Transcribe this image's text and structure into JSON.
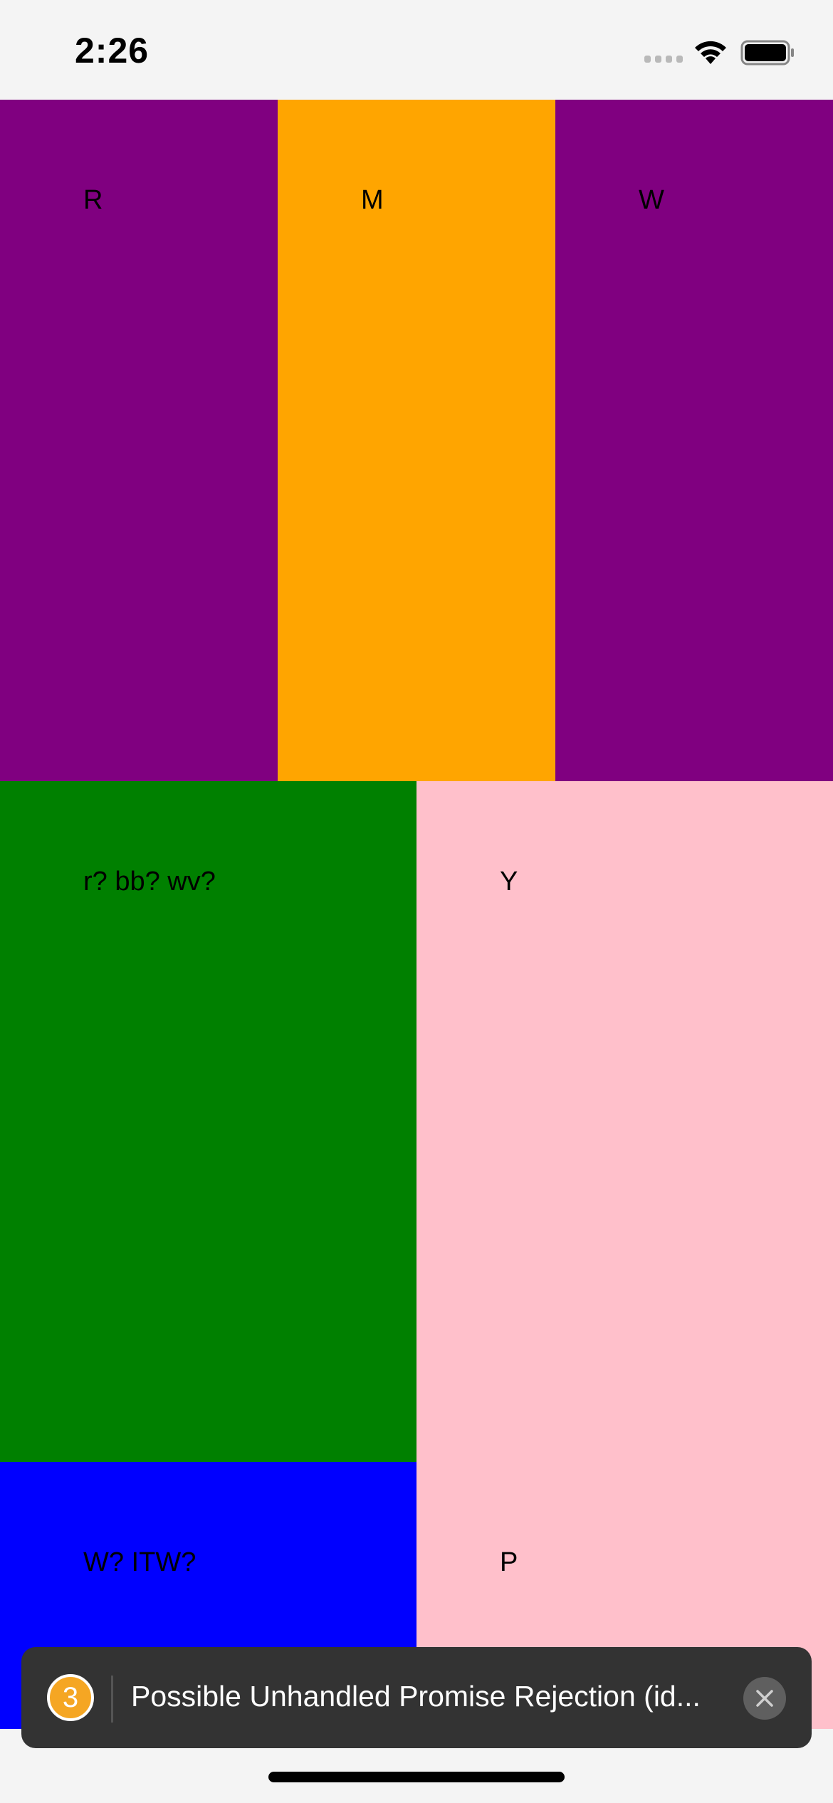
{
  "status_bar": {
    "time": "2:26"
  },
  "grid": {
    "cells": [
      {
        "id": "r",
        "label": "R",
        "color": "#800080"
      },
      {
        "id": "m",
        "label": "M",
        "color": "#ffa500"
      },
      {
        "id": "w",
        "label": "W",
        "color": "#800080"
      },
      {
        "id": "rbbwv",
        "label": "r? bb? wv?",
        "color": "#008000"
      },
      {
        "id": "y",
        "label": "Y",
        "color": "#ffc0cb"
      },
      {
        "id": "witw",
        "label": "W? ITW?",
        "color": "#0000ff"
      },
      {
        "id": "p",
        "label": "P",
        "color": "#ffc0cb"
      }
    ]
  },
  "toast": {
    "count": "3",
    "message": "Possible Unhandled Promise Rejection (id...",
    "badge_color": "#f5a623",
    "icons": {
      "close": "close-icon"
    }
  }
}
